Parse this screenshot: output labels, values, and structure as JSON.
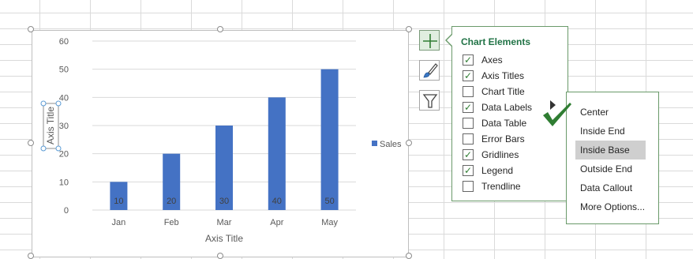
{
  "chart_data": {
    "type": "bar",
    "categories": [
      "Jan",
      "Feb",
      "Mar",
      "Apr",
      "May"
    ],
    "series": [
      {
        "name": "Sales",
        "values": [
          10,
          20,
          30,
          40,
          50
        ]
      }
    ],
    "data_labels": [
      "10",
      "20",
      "30",
      "40",
      "50"
    ],
    "y_ticks": [
      "0",
      "10",
      "20",
      "30",
      "40",
      "50",
      "60"
    ],
    "ylim": [
      0,
      60
    ],
    "xlabel": "Axis Title",
    "ylabel": "Axis Title",
    "legend_position": "right",
    "grid": true,
    "bar_color": "#4472c4"
  },
  "tool_buttons": [
    {
      "icon": "plus-icon",
      "active": true
    },
    {
      "icon": "paintbrush-icon",
      "active": false
    },
    {
      "icon": "filter-icon",
      "active": false
    }
  ],
  "chart_elements_panel": {
    "title": "Chart Elements",
    "items": [
      {
        "label": "Axes",
        "checked": true
      },
      {
        "label": "Axis Titles",
        "checked": true
      },
      {
        "label": "Chart Title",
        "checked": false
      },
      {
        "label": "Data Labels",
        "checked": true
      },
      {
        "label": "Data Table",
        "checked": false
      },
      {
        "label": "Error Bars",
        "checked": false
      },
      {
        "label": "Gridlines",
        "checked": true
      },
      {
        "label": "Legend",
        "checked": true
      },
      {
        "label": "Trendline",
        "checked": false
      }
    ]
  },
  "data_labels_submenu": {
    "items": [
      "Center",
      "Inside End",
      "Inside Base",
      "Outside End",
      "Data Callout",
      "More Options..."
    ],
    "highlighted": "Inside Base"
  },
  "colors": {
    "accent_green": "#217346",
    "check_green": "#2f7d32"
  }
}
